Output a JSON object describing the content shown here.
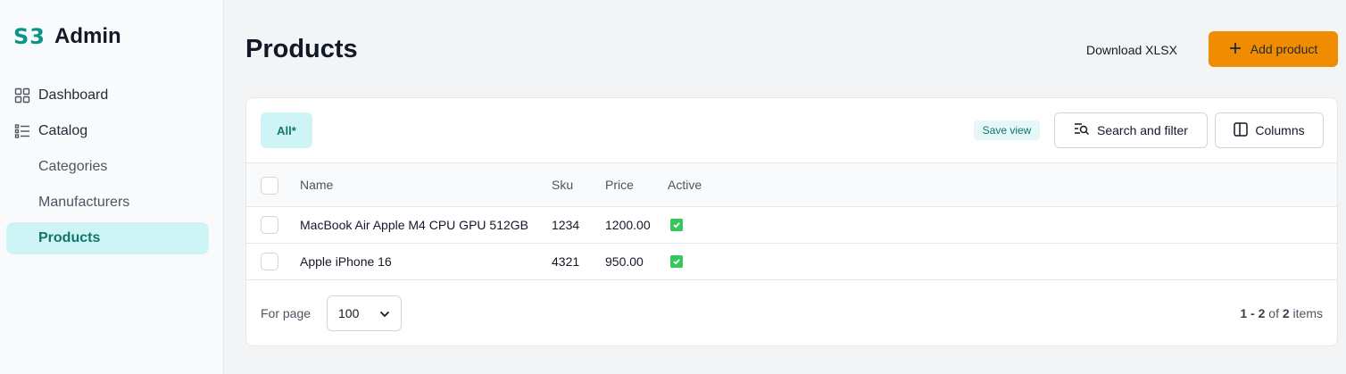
{
  "brand": {
    "logo": "S3",
    "name": "Admin"
  },
  "sidebar": {
    "items": [
      {
        "label": "Dashboard",
        "icon": "grid-icon"
      },
      {
        "label": "Catalog",
        "icon": "list-icon"
      },
      {
        "label": "Categories"
      },
      {
        "label": "Manufacturers"
      },
      {
        "label": "Products",
        "active": true
      }
    ]
  },
  "header": {
    "title": "Products",
    "download_label": "Download XLSX",
    "add_label": "Add product",
    "add_color": "#f08c00"
  },
  "toolbar": {
    "tab_all": "All*",
    "save_view": "Save view",
    "search_filter": "Search and filter",
    "columns": "Columns"
  },
  "table": {
    "columns": [
      "Name",
      "Sku",
      "Price",
      "Active"
    ],
    "rows": [
      {
        "name": "MacBook Air Apple M4 CPU GPU 512GB",
        "sku": "1234",
        "price": "1200.00",
        "active": true
      },
      {
        "name": "Apple iPhone 16",
        "sku": "4321",
        "price": "950.00",
        "active": true
      }
    ]
  },
  "footer": {
    "for_page_label": "For page",
    "page_size": "100",
    "range": "1 - 2",
    "of": "of",
    "total": "2",
    "items_label": "items"
  }
}
